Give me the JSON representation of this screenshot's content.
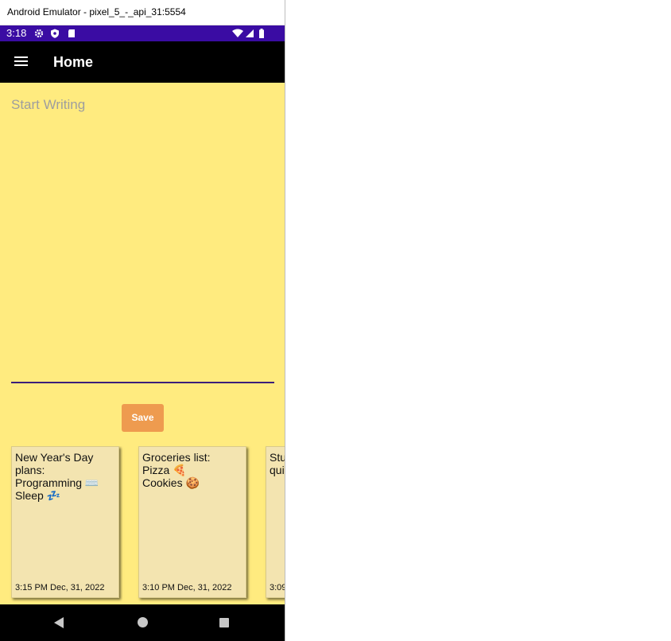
{
  "window": {
    "title": "Android Emulator - pixel_5_-_api_31:5554"
  },
  "status_bar": {
    "time": "3:18",
    "left_icons": [
      "gear-icon",
      "shield-icon",
      "sd-card-icon"
    ],
    "right_icons": [
      "wifi-icon",
      "signal-icon",
      "battery-icon"
    ],
    "background": "#3a0ca3"
  },
  "app_bar": {
    "title": "Home",
    "menu_icon": "hamburger-menu-icon"
  },
  "editor": {
    "placeholder": "Start Writing",
    "value": ""
  },
  "save_button": {
    "label": "Save",
    "color": "#ee9b4f"
  },
  "notes": [
    {
      "text": "New Year's Day plans:\nProgramming ⌨️\nSleep 💤",
      "date": "3:15 PM Dec, 31, 2022"
    },
    {
      "text": "Groceries list:\nPizza 🍕\nCookies 🍪",
      "date": "3:10 PM Dec, 31, 2022"
    },
    {
      "text": "Stu\nqui",
      "date": "3:09"
    }
  ],
  "nav_bar": {
    "icons": [
      "back-icon",
      "home-icon",
      "recents-icon"
    ]
  },
  "colors": {
    "page_background": "#ffeb7f",
    "card_background": "#f3e4b0",
    "app_bar": "#000000"
  }
}
